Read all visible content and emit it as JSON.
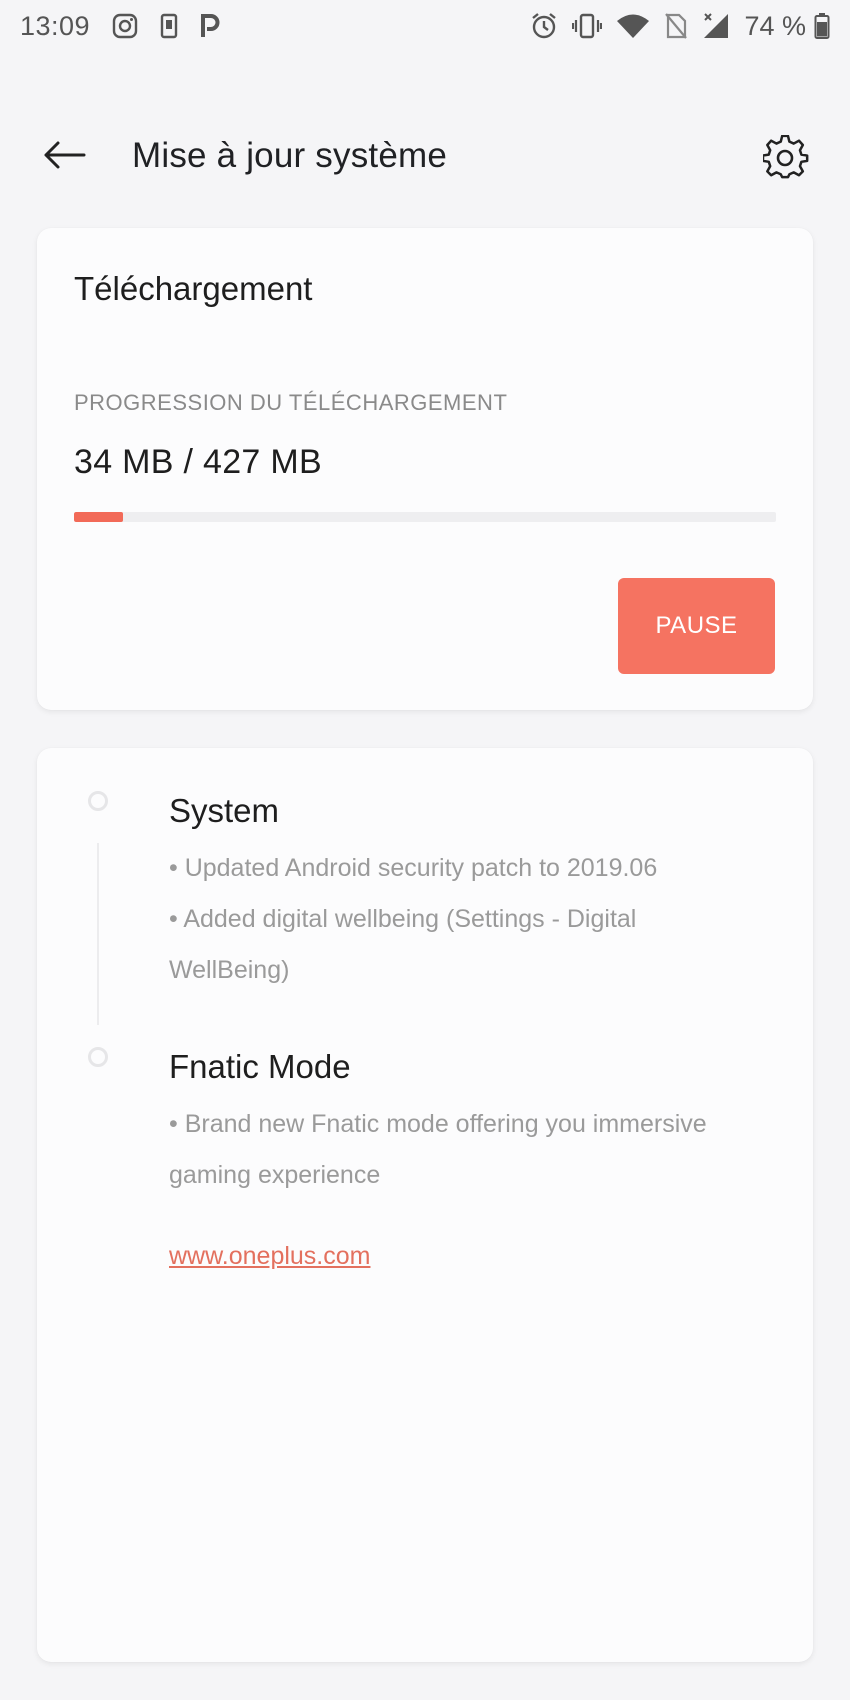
{
  "status_bar": {
    "time": "13:09",
    "battery_percent": "74 %",
    "icons_left": [
      "instagram-icon",
      "phone-icon",
      "p-app-icon"
    ],
    "icons_right": [
      "alarm-icon",
      "vibrate-icon",
      "wifi-icon",
      "no-sim-icon",
      "signal-icon",
      "battery-icon"
    ]
  },
  "app_bar": {
    "title": "Mise à jour système"
  },
  "download": {
    "title": "Téléchargement",
    "progress_label": "PROGRESSION DU TÉLÉCHARGEMENT",
    "progress_text": "34 MB / 427 MB",
    "progress_fraction": 0.07,
    "pause_label": "PAUSE"
  },
  "changelog": {
    "sections": [
      {
        "title": "System",
        "lines": [
          "• Updated Android security patch to 2019.06",
          "• Added digital wellbeing (Settings - Digital",
          "WellBeing)"
        ]
      },
      {
        "title": "Fnatic Mode",
        "lines": [
          "• Brand new Fnatic mode offering you immersive",
          "gaming experience"
        ]
      }
    ],
    "link": "www.oneplus.com"
  },
  "colors": {
    "accent": "#f57361",
    "background": "#f5f5f7",
    "card": "#fcfcfd"
  }
}
